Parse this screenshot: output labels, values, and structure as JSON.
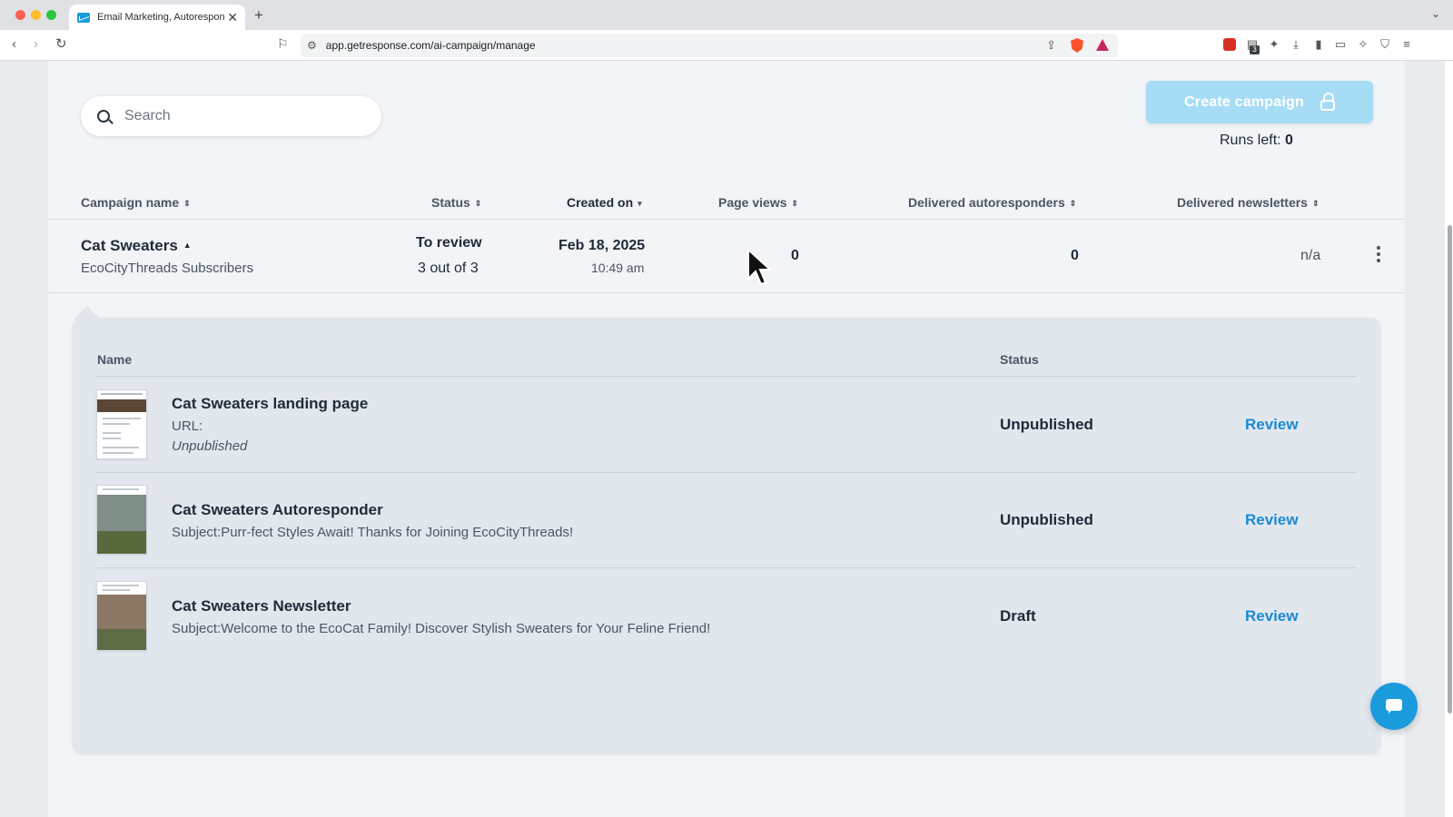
{
  "browser": {
    "tab_title": "Email Marketing, Autorespond",
    "tab_close": "✕",
    "new_tab": "+",
    "url": "app.getresponse.com/ai-campaign/manage",
    "extension_badge": "3"
  },
  "toolbar": {
    "search_placeholder": "Search",
    "create_campaign_label": "Create campaign",
    "runs_left_label": "Runs left:",
    "runs_left_value": "0"
  },
  "table": {
    "columns": [
      "Campaign name",
      "Status",
      "Created on",
      "Page views",
      "Delivered autoresponders",
      "Delivered newsletters"
    ],
    "campaign": {
      "name": "Cat Sweaters",
      "list": "EcoCityThreads Subscribers",
      "status": "To review",
      "progress": "3 out of 3",
      "created_date": "Feb 18, 2025",
      "created_time": "10:49 am",
      "page_views": "0",
      "delivered_autoresponders": "0",
      "delivered_newsletters": "n/a"
    }
  },
  "details": {
    "columns": [
      "Name",
      "Status"
    ],
    "items": [
      {
        "title": "Cat Sweaters landing page",
        "line1": "URL:",
        "line2": "Unpublished",
        "status": "Unpublished",
        "action": "Review"
      },
      {
        "title": "Cat Sweaters Autoresponder",
        "line1": "Subject:Purr-fect Styles Await! Thanks for Joining EcoCityThreads!",
        "status": "Unpublished",
        "action": "Review"
      },
      {
        "title": "Cat Sweaters Newsletter",
        "line1": "Subject:Welcome to the EcoCat Family! Discover Stylish Sweaters for Your Feline Friend!",
        "status": "Draft",
        "action": "Review"
      }
    ]
  },
  "colors": {
    "accent": "#1a8ad4",
    "create_button_disabled": "#a7dcf5",
    "chat_button": "#1a9bdc"
  }
}
